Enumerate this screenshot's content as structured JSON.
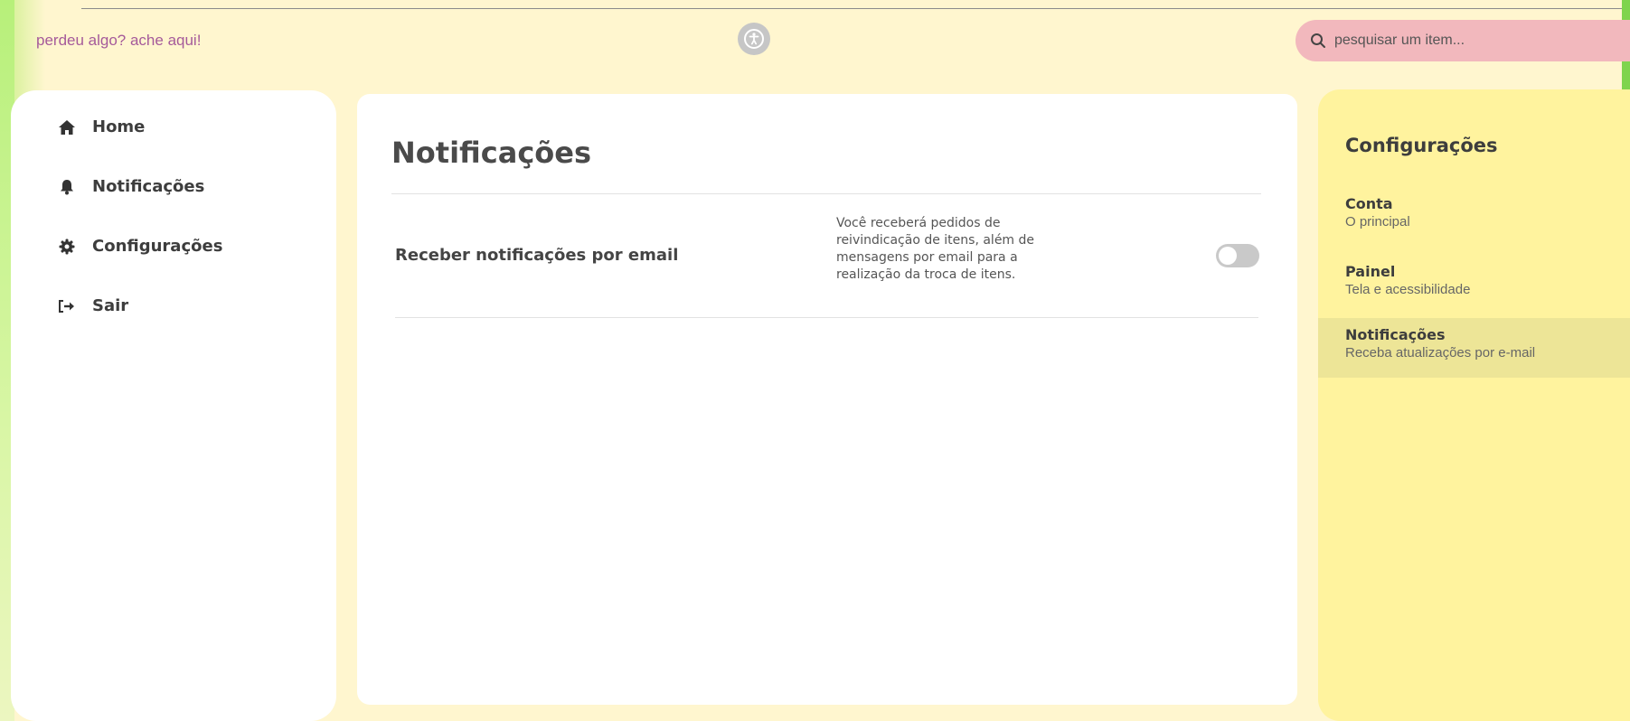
{
  "header": {
    "tagline": "perdeu algo? ache aqui!",
    "search_placeholder": "pesquisar um item..."
  },
  "sidebar": {
    "items": [
      {
        "label": "Home",
        "icon": "home-icon"
      },
      {
        "label": "Notificações",
        "icon": "bell-icon"
      },
      {
        "label": "Configurações",
        "icon": "gear-icon"
      },
      {
        "label": "Sair",
        "icon": "sign-out-icon"
      }
    ]
  },
  "main": {
    "title": "Notificações",
    "setting": {
      "label": "Receber notificações por email",
      "description": "Você receberá pedidos de reivindicação de itens, além de mensagens por email para a realização da troca de itens.",
      "enabled": false
    }
  },
  "settings_panel": {
    "title": "Configurações",
    "items": [
      {
        "title": "Conta",
        "subtitle": "O principal",
        "active": false
      },
      {
        "title": "Painel",
        "subtitle": "Tela e acessibilidade",
        "active": false
      },
      {
        "title": "Notificações",
        "subtitle": "Receba atualizações por e-mail",
        "active": true
      }
    ]
  },
  "colors": {
    "background": "#fff6cf",
    "tagline": "#a55a9a",
    "search_bg": "#f2b8bd",
    "right_panel": "#fff39e",
    "active_item": "#ede597",
    "accent_green": "#7fd44d"
  }
}
